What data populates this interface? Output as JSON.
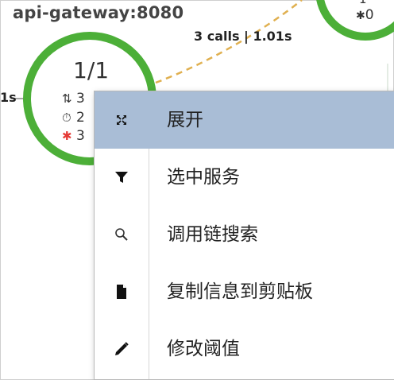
{
  "topology": {
    "service_name": "api-gateway:8080",
    "edge_label": "3 calls | 1.01s",
    "left_edge_label": "1s",
    "node": {
      "instances": "1/1",
      "calls": "3",
      "time": "2",
      "errors": "3"
    },
    "right_node": {
      "top_value": "1",
      "errors": "0"
    },
    "colors": {
      "node_ring": "#4caf38",
      "edge": "#e0b050",
      "error": "#e53935"
    }
  },
  "context_menu": {
    "items": [
      {
        "label": "展开",
        "icon": "expand-icon",
        "active": true
      },
      {
        "label": "选中服务",
        "icon": "filter-icon",
        "active": false
      },
      {
        "label": "调用链搜索",
        "icon": "search-icon",
        "active": false
      },
      {
        "label": "复制信息到剪贴板",
        "icon": "copy-icon",
        "active": false
      },
      {
        "label": "修改阈值",
        "icon": "pencil-icon",
        "active": false
      }
    ],
    "colors": {
      "active_bg": "#a9bdd6"
    }
  }
}
